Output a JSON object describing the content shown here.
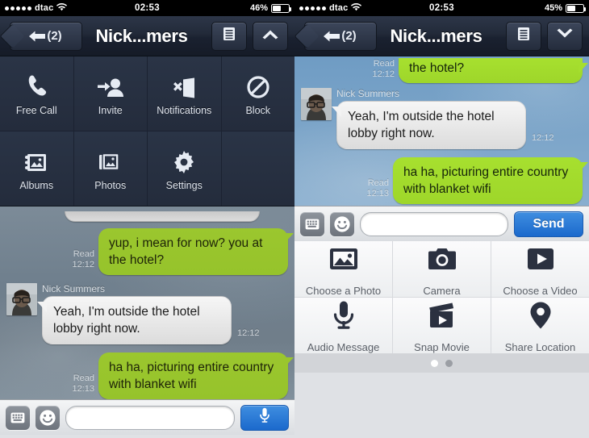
{
  "left": {
    "statusbar": {
      "carrier": "dtac",
      "signal_dots": 5,
      "wifi_icon": "wifi-icon",
      "time": "02:53",
      "battery_pct": "46%",
      "battery_level": 46
    },
    "navbar": {
      "back_label": "(2)",
      "back_icon": "back-arrow-icon",
      "title": "Nick...mers",
      "menu_icon": "list-menu-icon",
      "toggle_icon": "chevron-up-icon"
    },
    "menu": {
      "items": [
        {
          "label": "Free Call",
          "icon": "phone-icon"
        },
        {
          "label": "Invite",
          "icon": "add-person-icon"
        },
        {
          "label": "Notifications",
          "icon": "speaker-mute-icon"
        },
        {
          "label": "Block",
          "icon": "block-icon"
        },
        {
          "label": "Albums",
          "icon": "album-icon"
        },
        {
          "label": "Photos",
          "icon": "photos-icon"
        },
        {
          "label": "Settings",
          "icon": "gear-icon"
        }
      ]
    },
    "messages": [
      {
        "dir": "out",
        "text": "yup, i mean for now? you at the hotel?",
        "status": "Read",
        "time": "12:12"
      },
      {
        "dir": "in",
        "sender": "Nick Summers",
        "text": "Yeah, I'm outside the hotel lobby right now.",
        "time": "12:12"
      },
      {
        "dir": "out",
        "text": "ha ha, picturing entire country with blanket wifi",
        "status": "Read",
        "time": "12:13"
      }
    ],
    "input": {
      "keyboard_icon": "keyboard-icon",
      "emoji_icon": "smiley-icon",
      "value": "",
      "placeholder": "",
      "action_icon": "microphone-icon"
    }
  },
  "right": {
    "statusbar": {
      "carrier": "dtac",
      "signal_dots": 5,
      "wifi_icon": "wifi-icon",
      "time": "02:53",
      "battery_pct": "45%",
      "battery_level": 45
    },
    "navbar": {
      "back_label": "(2)",
      "back_icon": "back-arrow-icon",
      "title": "Nick...mers",
      "menu_icon": "list-menu-icon",
      "toggle_icon": "chevron-down-icon"
    },
    "messages": [
      {
        "dir": "out",
        "text": "the hotel?",
        "status": "Read",
        "time": "12:12"
      },
      {
        "dir": "in",
        "sender": "Nick Summers",
        "text": "Yeah, I'm outside the hotel lobby right now.",
        "time": "12:12"
      },
      {
        "dir": "out",
        "text": "ha ha, picturing entire country with blanket wifi",
        "status": "Read",
        "time": "12:13"
      }
    ],
    "input": {
      "keyboard_icon": "keyboard-icon",
      "emoji_icon": "smiley-icon",
      "value": "",
      "placeholder": "",
      "send_label": "Send"
    },
    "attachments": {
      "items": [
        {
          "label": "Choose a Photo",
          "icon": "photo-icon"
        },
        {
          "label": "Camera",
          "icon": "camera-icon"
        },
        {
          "label": "Choose a Video",
          "icon": "video-play-icon"
        },
        {
          "label": "Audio Message",
          "icon": "microphone-icon"
        },
        {
          "label": "Snap Movie",
          "icon": "clapboard-icon"
        },
        {
          "label": "Share Location",
          "icon": "map-pin-icon"
        }
      ],
      "pages": 2,
      "active_page": 1
    }
  },
  "colors": {
    "nav_dark": "#242c3c",
    "bubble_out": "#9bc72e",
    "bubble_out_bright": "#a7e02f",
    "bubble_in": "#f0f0f0",
    "accent_blue": "#2a77d6",
    "attach_bg": "#f0f1f3"
  }
}
